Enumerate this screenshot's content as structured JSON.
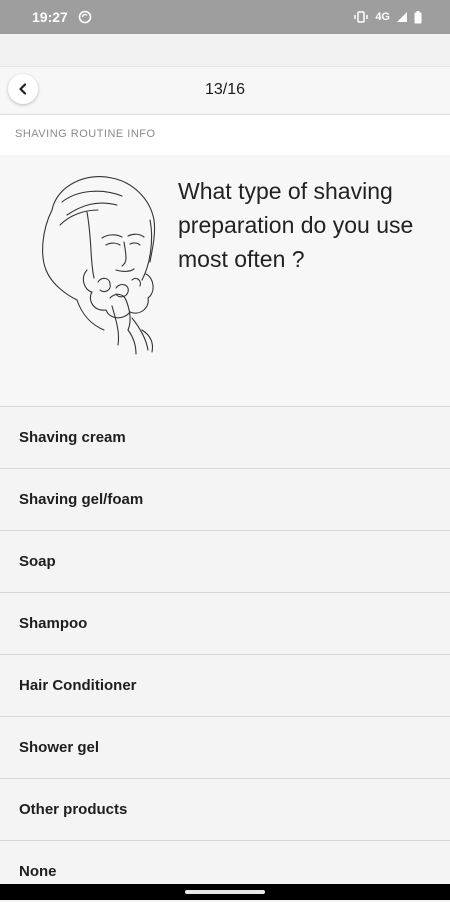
{
  "status_bar": {
    "time": "19:27",
    "network": "4G"
  },
  "header": {
    "counter": "13/16"
  },
  "section": {
    "title": "SHAVING ROUTINE INFO"
  },
  "question": {
    "text": "What type of shaving preparation do you use most often ?"
  },
  "options": [
    {
      "label": "Shaving cream"
    },
    {
      "label": "Shaving gel/foam"
    },
    {
      "label": "Soap"
    },
    {
      "label": "Shampoo"
    },
    {
      "label": "Hair Conditioner"
    },
    {
      "label": "Shower gel"
    },
    {
      "label": "Other products"
    },
    {
      "label": "None"
    }
  ]
}
